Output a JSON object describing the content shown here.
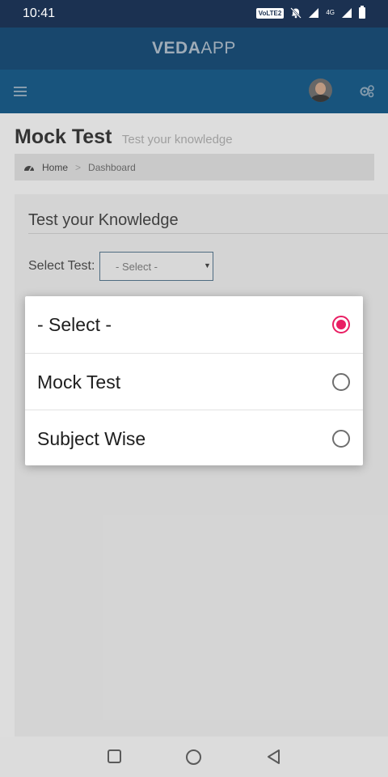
{
  "status_bar": {
    "time": "10:41",
    "volte_label": "VoLTE2",
    "network_label": "4G",
    "icons": [
      "volte-icon",
      "bell-off-icon",
      "signal-icon",
      "signal-4g-icon",
      "battery-icon"
    ]
  },
  "app_bar": {
    "brand_bold": "VEDA",
    "brand_light": "APP"
  },
  "nav": {
    "icons": [
      "menu-icon",
      "avatar",
      "gears-icon"
    ]
  },
  "page": {
    "title": "Mock Test",
    "subtitle": "Test your knowledge",
    "breadcrumb": {
      "home": "Home",
      "separator": ">",
      "current": "Dashboard"
    }
  },
  "panel": {
    "title": "Test your Knowledge",
    "select_label": "Select Test:",
    "select_value": "- Select -",
    "select_arrow": "▼"
  },
  "dialog": {
    "options": [
      {
        "label": "- Select -",
        "checked": true
      },
      {
        "label": "Mock Test",
        "checked": false
      },
      {
        "label": "Subject Wise",
        "checked": false
      }
    ]
  },
  "colors": {
    "status_bar": "#1b3151",
    "app_bar": "#1a4c74",
    "nav_bar": "#1a5a85",
    "radio_accent": "#e91e63"
  }
}
